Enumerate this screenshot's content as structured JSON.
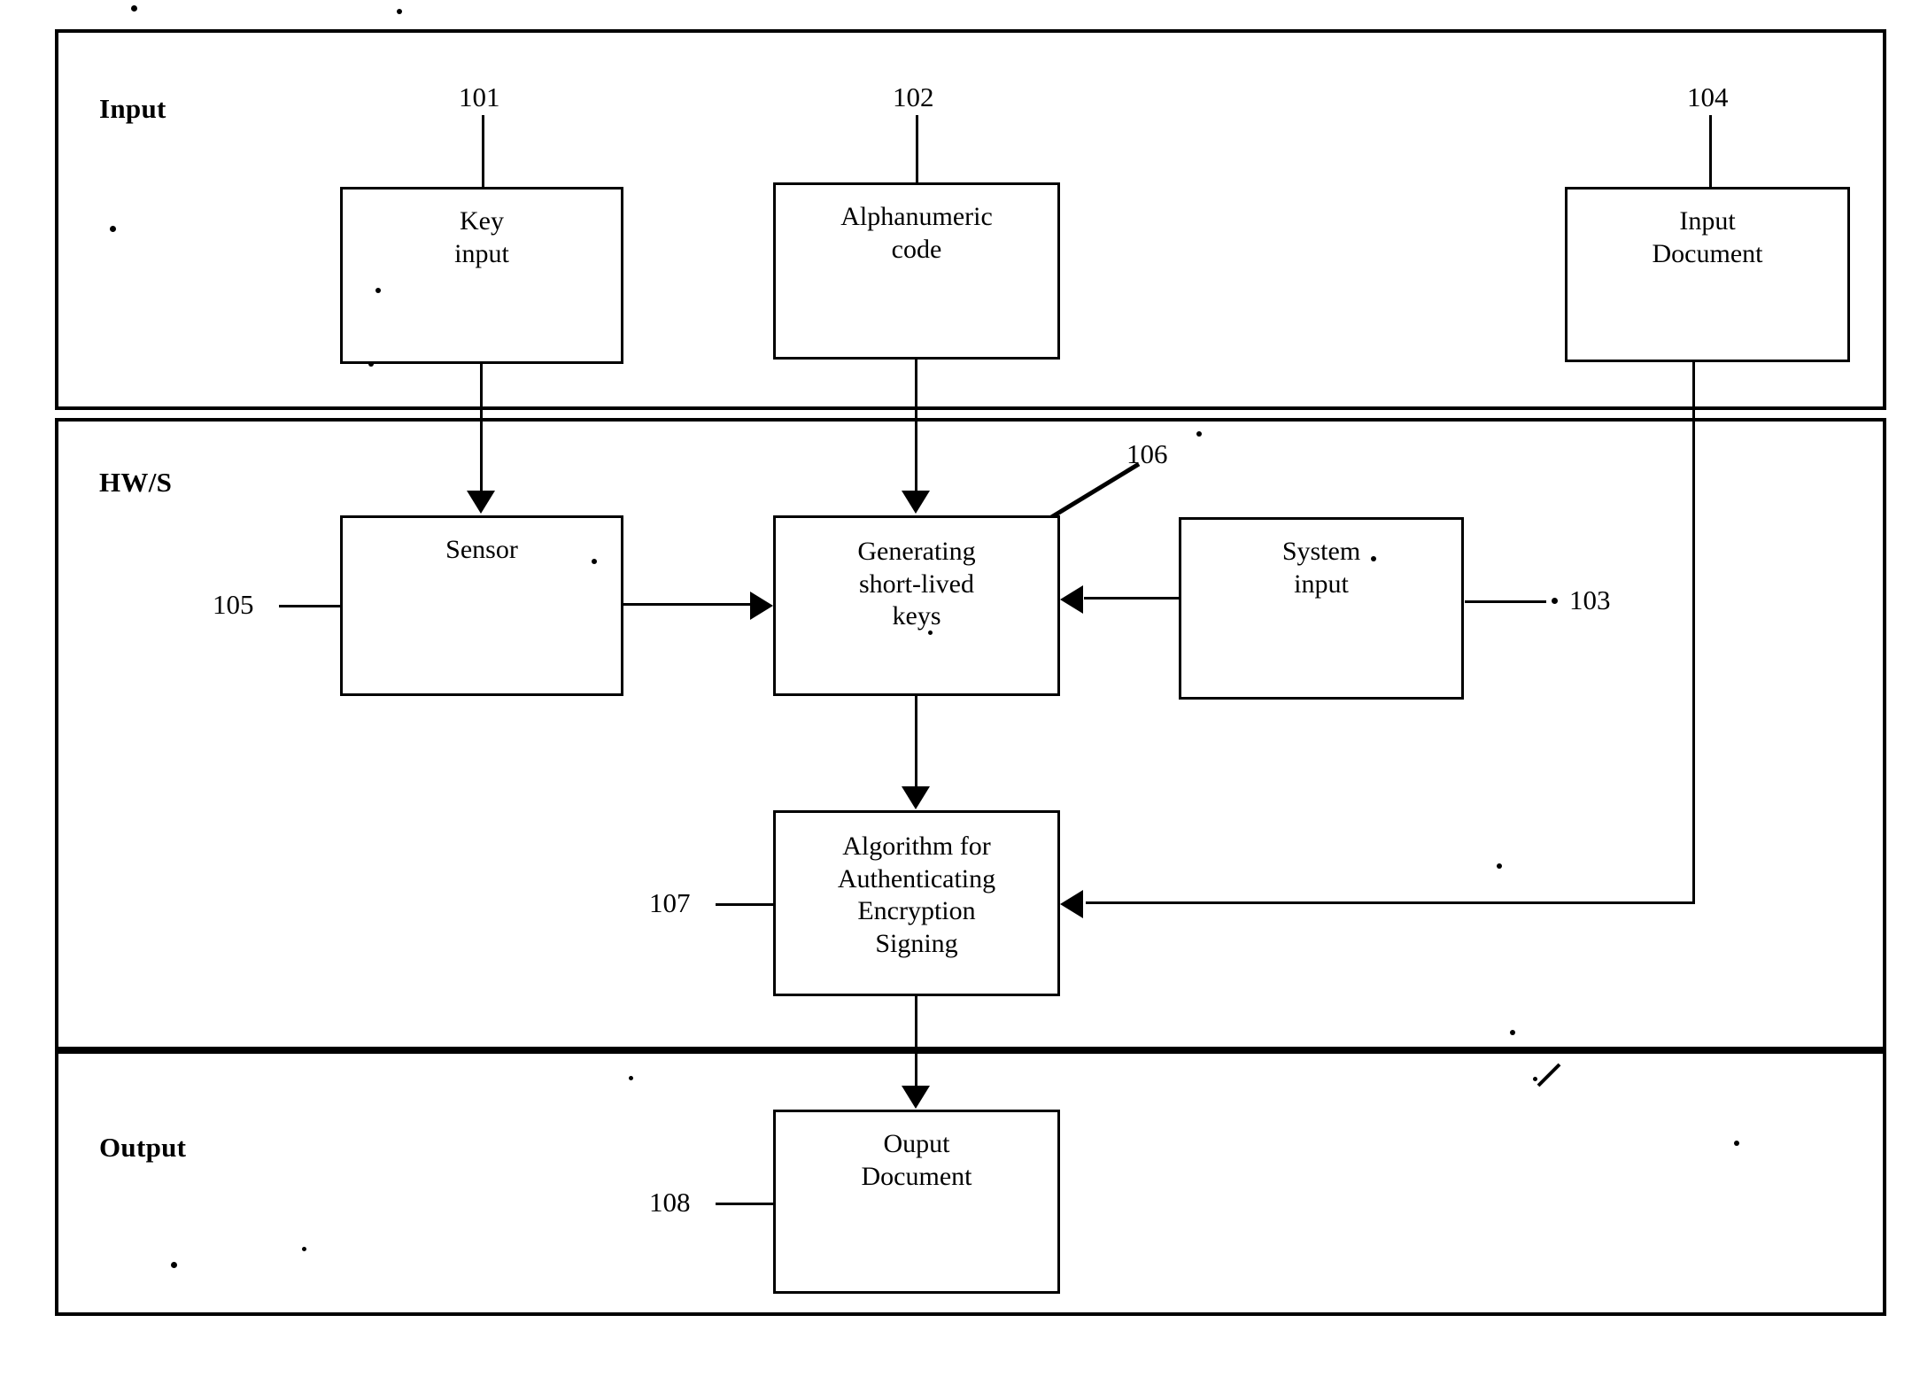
{
  "figure": {
    "type": "patent-block-diagram",
    "sections": [
      {
        "id": "input",
        "label": "Input"
      },
      {
        "id": "hws",
        "label": "HW/S"
      },
      {
        "id": "output",
        "label": "Output"
      }
    ],
    "boxes": [
      {
        "id": "key-input",
        "label": "Key\ninput",
        "ref": "101",
        "section": "input"
      },
      {
        "id": "alphanumeric-code",
        "label": "Alphanumeric\ncode",
        "ref": "102",
        "section": "input"
      },
      {
        "id": "input-document",
        "label": "Input\nDocument",
        "ref": "104",
        "section": "input"
      },
      {
        "id": "sensor",
        "label": "Sensor",
        "ref": "105",
        "section": "hws"
      },
      {
        "id": "generating-keys",
        "label": "Generating\nshort-lived\nkeys",
        "ref": "106",
        "section": "hws"
      },
      {
        "id": "system-input",
        "label": "System\ninput",
        "ref": "103",
        "section": "hws"
      },
      {
        "id": "algorithm",
        "label": "Algorithm for\nAuthenticating\nEncryption\nSigning",
        "ref": "107",
        "section": "hws"
      },
      {
        "id": "output-document",
        "label": "Ouput\nDocument",
        "ref": "108",
        "section": "output"
      }
    ],
    "reference_numerals": {
      "n101": "101",
      "n102": "102",
      "n103": "103",
      "n104": "104",
      "n105": "105",
      "n106": "106",
      "n107": "107",
      "n108": "108"
    },
    "connections": [
      {
        "from": "key-input",
        "to": "sensor",
        "kind": "arrow",
        "direction": "down"
      },
      {
        "from": "alphanumeric-code",
        "to": "generating-keys",
        "kind": "arrow",
        "direction": "down"
      },
      {
        "from": "sensor",
        "to": "generating-keys",
        "kind": "arrow",
        "direction": "right"
      },
      {
        "from": "system-input",
        "to": "generating-keys",
        "kind": "arrow",
        "direction": "left"
      },
      {
        "from": "generating-keys",
        "to": "algorithm",
        "kind": "arrow",
        "direction": "down"
      },
      {
        "from": "input-document",
        "to": "algorithm",
        "kind": "arrow",
        "direction": "left"
      },
      {
        "from": "algorithm",
        "to": "output-document",
        "kind": "arrow",
        "direction": "down"
      }
    ],
    "colors": {
      "ink": "#000000",
      "paper": "#ffffff"
    }
  }
}
